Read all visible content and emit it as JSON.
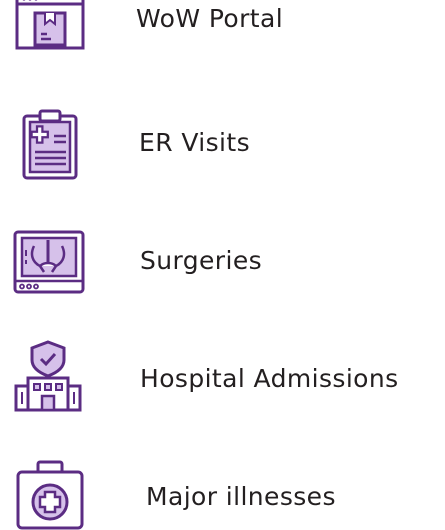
{
  "colors": {
    "accent": "#5b2c83",
    "accent_light": "#d6c1ea",
    "text": "#231f20"
  },
  "items": [
    {
      "label": "WoW Portal",
      "icon": "browser-window-icon"
    },
    {
      "label": "ER Visits",
      "icon": "medical-clipboard-icon"
    },
    {
      "label": "Surgeries",
      "icon": "xray-monitor-icon"
    },
    {
      "label": "Hospital Admissions",
      "icon": "hospital-building-icon"
    },
    {
      "label": "Major illnesses",
      "icon": "first-aid-kit-icon"
    }
  ]
}
